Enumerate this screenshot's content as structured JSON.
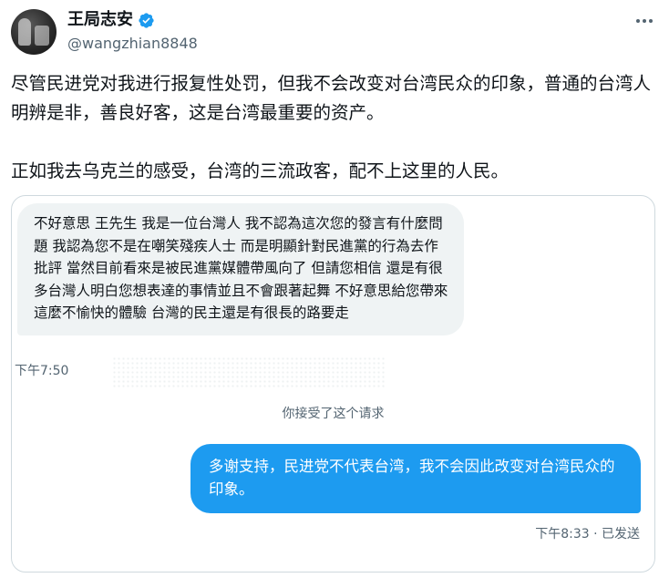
{
  "author": {
    "display_name": "王局志安",
    "handle": "@wangzhian8848",
    "avatar_icon": "profile-photo",
    "verified_icon": "verified-badge-icon",
    "verified_color": "#1d9bf0"
  },
  "tweet": {
    "paragraphs": [
      "尽管民进党对我进行报复性处罚，但我不会改变对台湾民众的印象，普通的台湾人明辨是非，善良好客，这是台湾最重要的资产。",
      "正如我去乌克兰的感受，台湾的三流政客，配不上这里的人民。"
    ]
  },
  "conversation": {
    "incoming_message": "不好意思 王先生 我是一位台灣人 我不認為這次您的發言有什麼問題 我認為您不是在嘲笑殘疾人士 而是明顯針對民進黨的行為去作批評 當然目前看來是被民進黨媒體帶風向了 但請您相信 還是有很多台灣人明白您想表達的事情並且不會跟著起舞 不好意思給您帶來這麼不愉快的體驗 台灣的民主還是有很長的路要走",
    "incoming_time": "下午7:50",
    "accepted_notice": "你接受了这个请求",
    "outgoing_message": "多谢支持，民进党不代表台湾，我不会因此改变对台湾民众的印象。",
    "outgoing_status": "下午8:33 · 已发送",
    "outgoing_bubble_color": "#1d9bf0",
    "incoming_bubble_color": "#eff3f4"
  }
}
